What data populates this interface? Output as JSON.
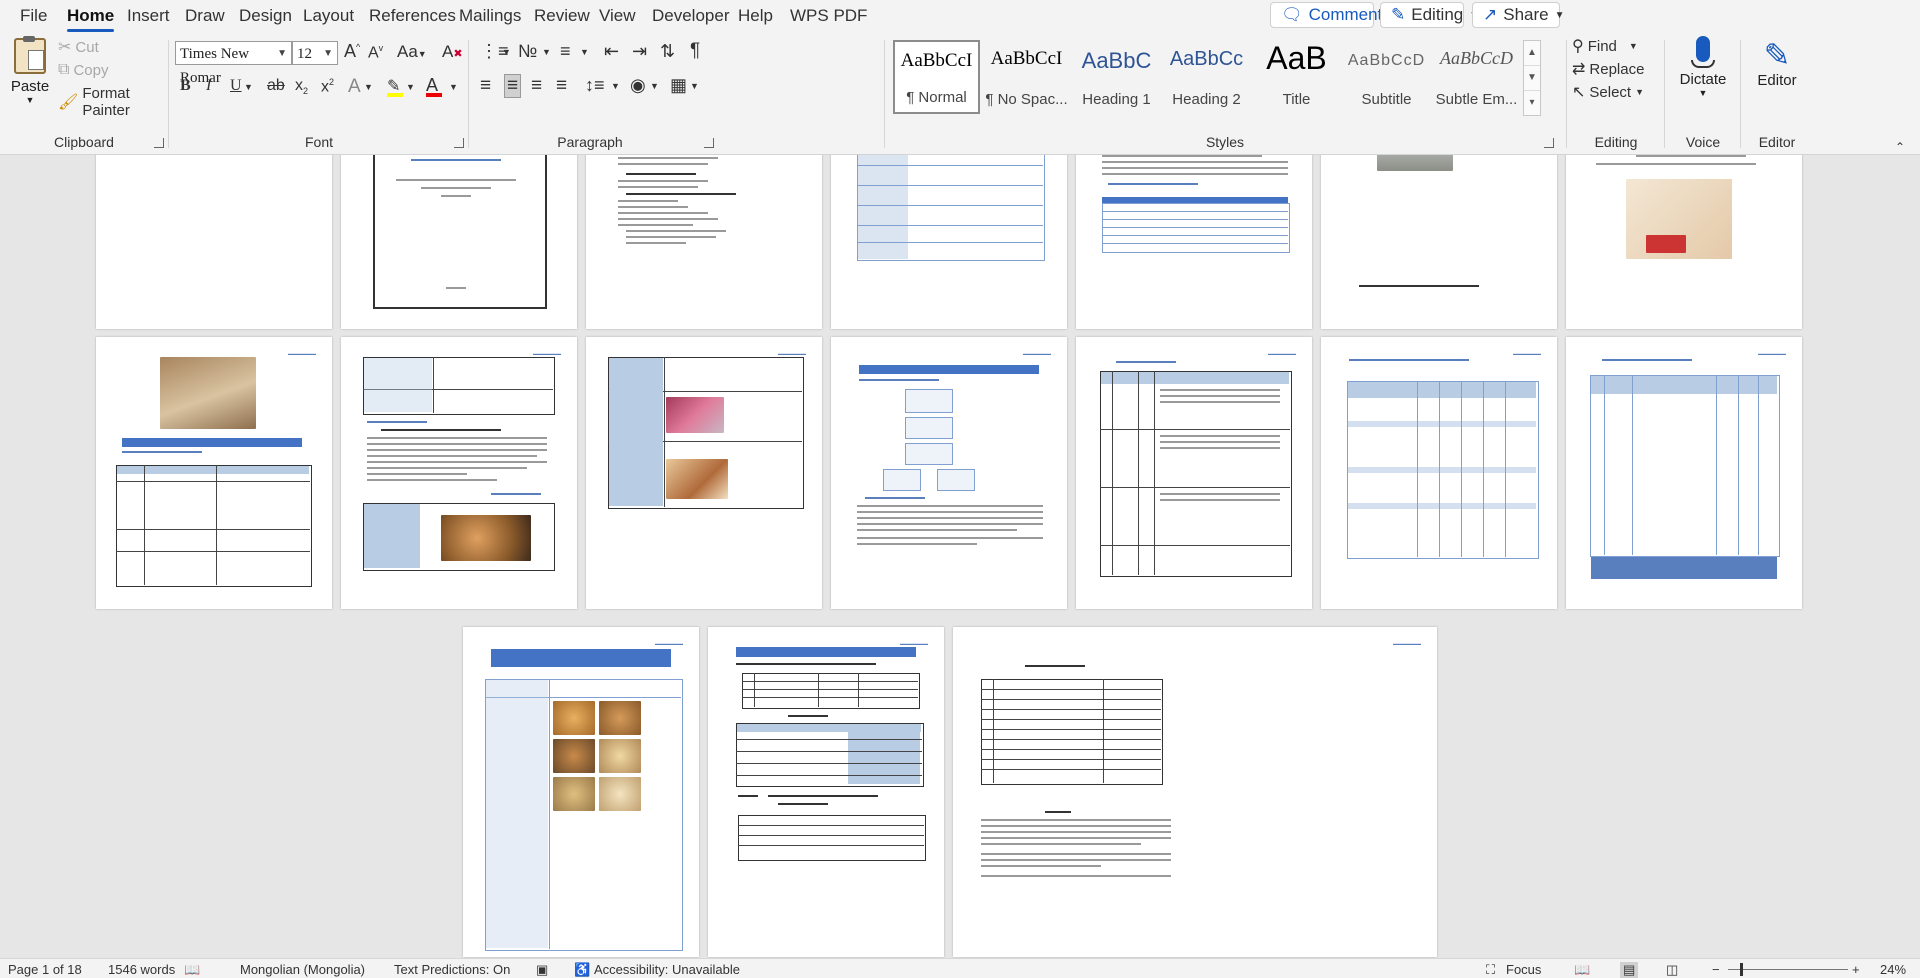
{
  "menu": {
    "tabs": [
      "File",
      "Home",
      "Insert",
      "Draw",
      "Design",
      "Layout",
      "References",
      "Mailings",
      "Review",
      "View",
      "Developer",
      "Help",
      "WPS PDF"
    ],
    "active": "Home",
    "comments": "Comments",
    "editing": "Editing",
    "share": "Share"
  },
  "clipboard": {
    "paste": "Paste",
    "cut": "Cut",
    "copy": "Copy",
    "format_painter": "Format Painter",
    "label": "Clipboard"
  },
  "font": {
    "name": "Times New Romar",
    "size": "12",
    "label": "Font"
  },
  "paragraph": {
    "label": "Paragraph"
  },
  "styles": {
    "items": [
      {
        "preview": "AaBbCcI",
        "name": "¶ Normal"
      },
      {
        "preview": "AaBbCcI",
        "name": "¶ No Spac..."
      },
      {
        "preview": "AaBbC",
        "name": "Heading 1"
      },
      {
        "preview": "AaBbCc",
        "name": "Heading 2"
      },
      {
        "preview": "AaB",
        "name": "Title"
      },
      {
        "preview": "AaBbCcD",
        "name": "Subtitle"
      },
      {
        "preview": "AaBbCcD",
        "name": "Subtle Em..."
      }
    ],
    "label": "Styles"
  },
  "editing_group": {
    "find": "Find",
    "replace": "Replace",
    "select": "Select",
    "label": "Editing"
  },
  "voice": {
    "dictate": "Dictate",
    "label": "Voice"
  },
  "editor": {
    "button": "Editor",
    "label": "Editor"
  },
  "status": {
    "page": "Page 1 of 18",
    "words": "1546 words",
    "language": "Mongolian (Mongolia)",
    "predictions": "Text Predictions: On",
    "accessibility": "Accessibility: Unavailable",
    "focus": "Focus",
    "zoom": "24%"
  },
  "colors": {
    "accent": "#185abd",
    "table_blue": "#4472c4",
    "light_blue": "#b8cce4"
  }
}
